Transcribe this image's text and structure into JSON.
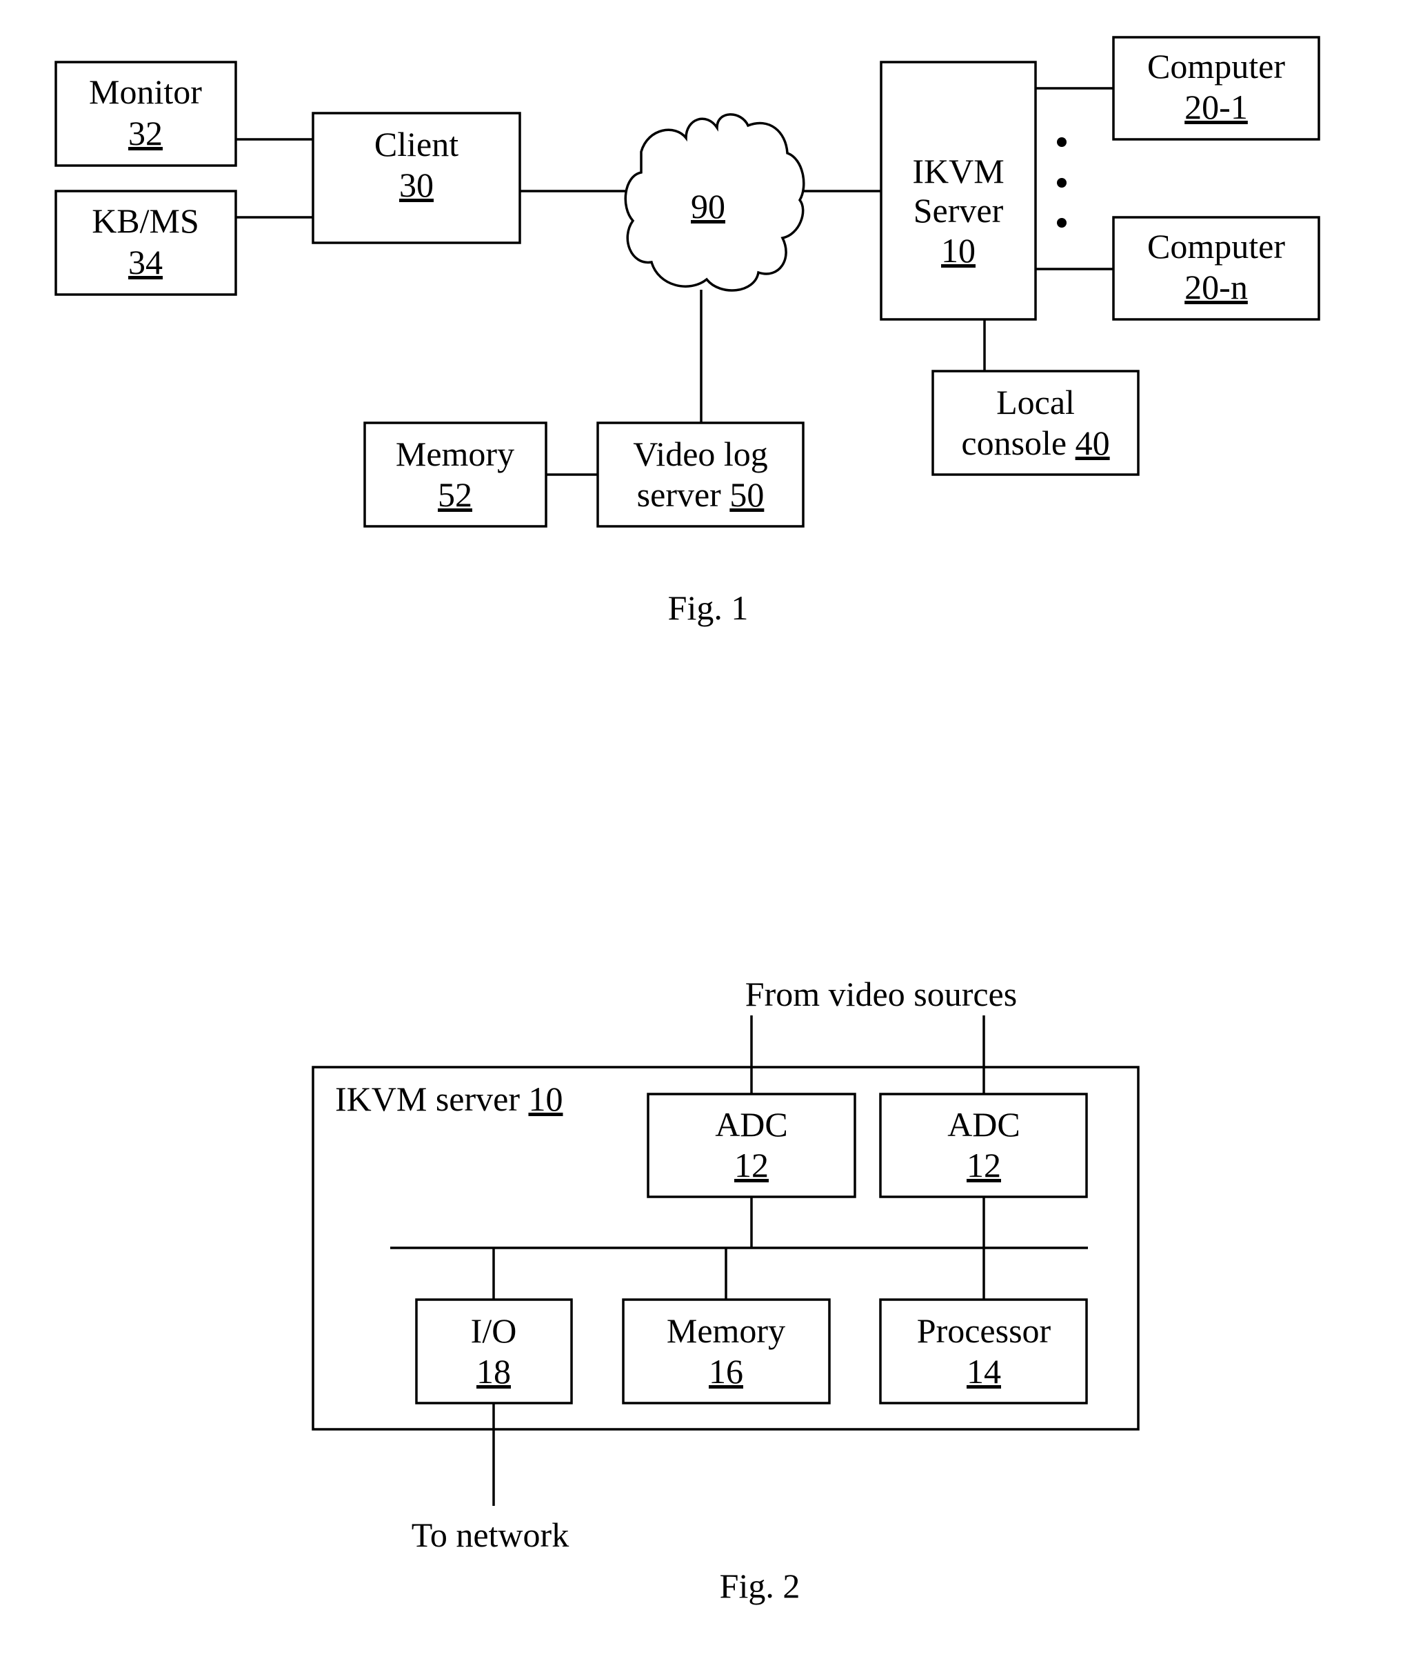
{
  "fig1": {
    "caption": "Fig. 1",
    "monitor": {
      "line1": "Monitor",
      "ref": "32"
    },
    "kbms": {
      "line1": "KB/MS",
      "ref": "34"
    },
    "client": {
      "line1": "Client",
      "ref": "30"
    },
    "network": {
      "ref": "90"
    },
    "ikvm_server": {
      "line1": "IKVM",
      "line2": "Server",
      "ref": "10"
    },
    "computer_1": {
      "line1": "Computer",
      "ref": "20-1"
    },
    "computer_n": {
      "line1": "Computer",
      "ref": "20-n"
    },
    "ellipsis": "• • •",
    "local_console": {
      "line1": "Local",
      "line2": "console",
      "ref": "40"
    },
    "memory": {
      "line1": "Memory",
      "ref": "52"
    },
    "video_log_server": {
      "line1": "Video log",
      "line2": "server",
      "ref": "50"
    }
  },
  "fig2": {
    "caption": "Fig. 2",
    "from_label": "From video sources",
    "to_label": "To network",
    "server_label": "IKVM server",
    "server_ref": "10",
    "adc_left": {
      "line1": "ADC",
      "ref": "12"
    },
    "adc_right": {
      "line1": "ADC",
      "ref": "12"
    },
    "io": {
      "line1": "I/O",
      "ref": "18"
    },
    "memory": {
      "line1": "Memory",
      "ref": "16"
    },
    "processor": {
      "line1": "Processor",
      "ref": "14"
    }
  }
}
